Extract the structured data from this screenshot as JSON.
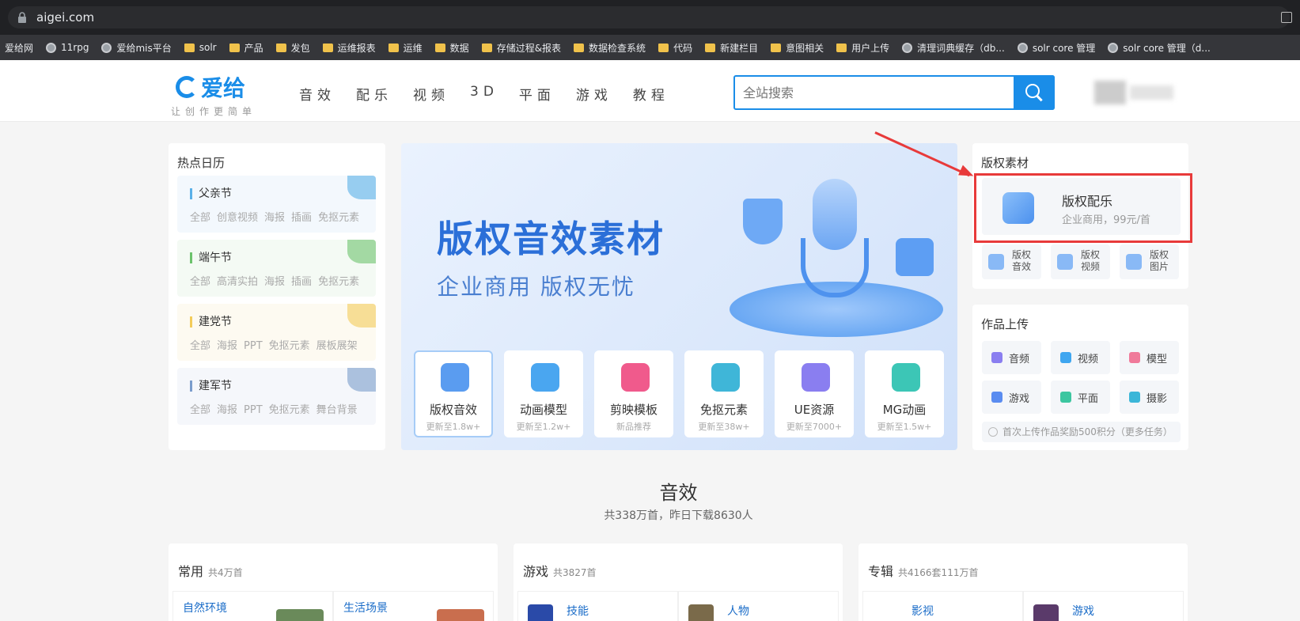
{
  "browser": {
    "url": "aigei.com",
    "bookmarks": [
      {
        "label": "爱给网",
        "icon": "none"
      },
      {
        "label": "11rpg",
        "icon": "globe"
      },
      {
        "label": "爱给mis平台",
        "icon": "globe"
      },
      {
        "label": "solr",
        "icon": "folder"
      },
      {
        "label": "产品",
        "icon": "folder"
      },
      {
        "label": "发包",
        "icon": "folder"
      },
      {
        "label": "运维报表",
        "icon": "folder"
      },
      {
        "label": "运维",
        "icon": "folder"
      },
      {
        "label": "数据",
        "icon": "folder"
      },
      {
        "label": "存储过程&报表",
        "icon": "folder"
      },
      {
        "label": "数据检查系统",
        "icon": "folder"
      },
      {
        "label": "代码",
        "icon": "folder"
      },
      {
        "label": "新建栏目",
        "icon": "folder"
      },
      {
        "label": "意图相关",
        "icon": "folder"
      },
      {
        "label": "用户上传",
        "icon": "folder"
      },
      {
        "label": "清理词典缓存（db...",
        "icon": "globe"
      },
      {
        "label": "solr core 管理",
        "icon": "globe"
      },
      {
        "label": "solr core 管理（d...",
        "icon": "globe"
      }
    ]
  },
  "header": {
    "logo": "爱给",
    "slogan": "让创作更简单",
    "nav": [
      "音效",
      "配乐",
      "视频",
      "3D",
      "平面",
      "游戏",
      "教程"
    ],
    "search_placeholder": "全站搜索"
  },
  "calendar": {
    "title": "热点日历",
    "festivals": [
      {
        "name": "父亲节",
        "links": [
          "全部",
          "创意视频",
          "海报",
          "插画",
          "免抠元素"
        ],
        "accent": "#5ab0e8",
        "bg": "#f3f8fd"
      },
      {
        "name": "端午节",
        "links": [
          "全部",
          "高清实拍",
          "海报",
          "插画",
          "免抠元素"
        ],
        "accent": "#6cc36c",
        "bg": "#f4faf4"
      },
      {
        "name": "建党节",
        "links": [
          "全部",
          "海报",
          "PPT",
          "免抠元素",
          "展板展架"
        ],
        "accent": "#f3cc5a",
        "bg": "#fdfaf1"
      },
      {
        "name": "建军节",
        "links": [
          "全部",
          "海报",
          "PPT",
          "免抠元素",
          "舞台背景"
        ],
        "accent": "#7a9ccc",
        "bg": "#f5f7fb"
      }
    ]
  },
  "banner": {
    "title": "版权音效素材",
    "subtitle": "企业商用 版权无忧",
    "tiles": [
      {
        "name": "版权音效",
        "note": "更新至1.8w+",
        "color": "#5a9cf0"
      },
      {
        "name": "动画模型",
        "note": "更新至1.2w+",
        "color": "#4aa6f0"
      },
      {
        "name": "剪映模板",
        "note": "新品推荐",
        "color": "#f05a8c"
      },
      {
        "name": "免抠元素",
        "note": "更新至38w+",
        "color": "#3fb6d8"
      },
      {
        "name": "UE资源",
        "note": "更新至7000+",
        "color": "#8a7ef0"
      },
      {
        "name": "MG动画",
        "note": "更新至1.5w+",
        "color": "#3cc6b6"
      }
    ]
  },
  "copyright": {
    "title": "版权素材",
    "main_title": "版权配乐",
    "main_sub": "企业商用，99元/首",
    "minis": [
      "版权音效",
      "版权视频",
      "版权图片"
    ]
  },
  "upload": {
    "title": "作品上传",
    "items": [
      {
        "label": "音频",
        "color": "#8a7ef0"
      },
      {
        "label": "视频",
        "color": "#3fa6f0"
      },
      {
        "label": "模型",
        "color": "#f07a9a"
      },
      {
        "label": "游戏",
        "color": "#5a8cf0"
      },
      {
        "label": "平面",
        "color": "#3cc6a0"
      },
      {
        "label": "摄影",
        "color": "#3cb6d8"
      }
    ],
    "note": "首次上传作品奖励500积分（更多任务）"
  },
  "sound": {
    "title": "音效",
    "subtitle": "共338万首，昨日下载8630人",
    "panels": [
      {
        "title": "常用",
        "count": "共4万首",
        "cells": [
          "自然环境",
          "生活场景"
        ]
      },
      {
        "title": "游戏",
        "count": "共3827首",
        "cells": [
          "技能",
          "人物"
        ]
      },
      {
        "title": "专辑",
        "count": "共4166套111万首",
        "cells": [
          "影视",
          "游戏"
        ]
      }
    ]
  }
}
